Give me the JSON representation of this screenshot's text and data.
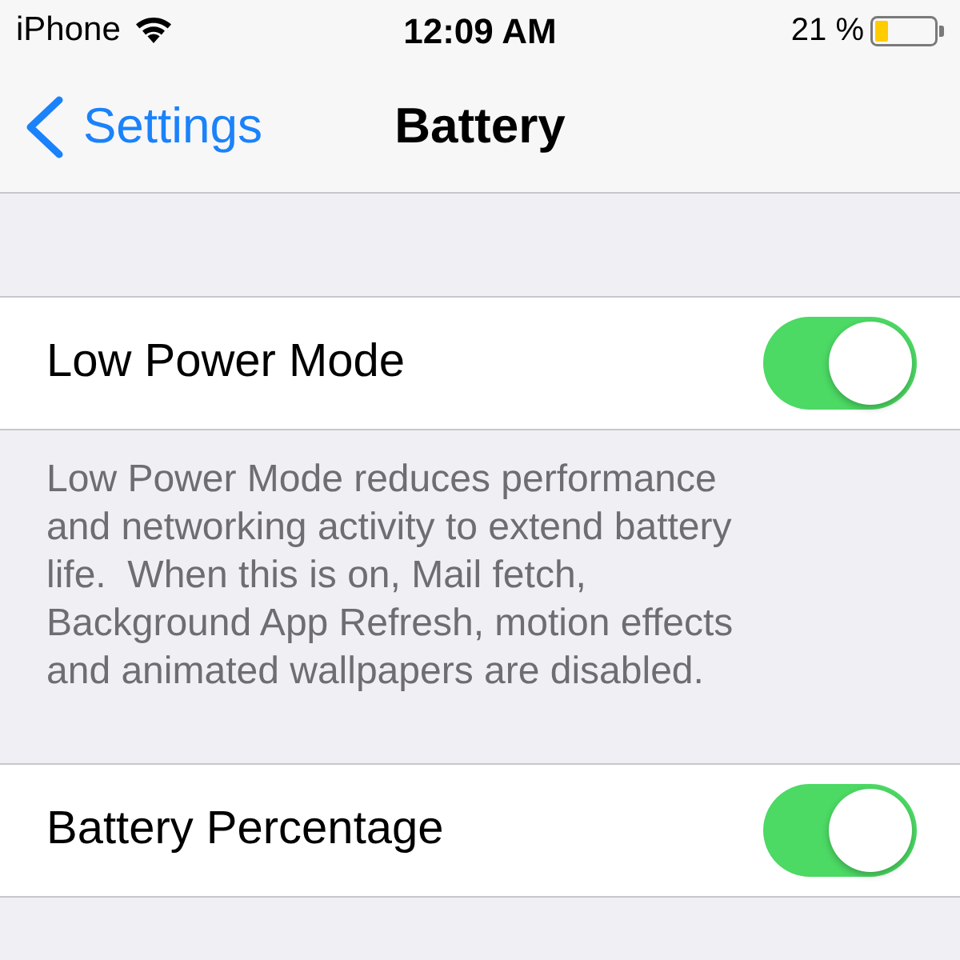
{
  "status_bar": {
    "carrier": "iPhone",
    "time": "12:09 AM",
    "battery_percent": "21 %"
  },
  "nav_bar": {
    "back_label": "Settings",
    "title": "Battery"
  },
  "sections": [
    {
      "label": "Low Power Mode",
      "on": true,
      "footer": "Low Power Mode reduces performance and networking activity to extend battery life.  When this is on, Mail fetch, Background App Refresh, motion effects and animated wallpapers are disabled."
    },
    {
      "label": "Battery Percentage",
      "on": true
    }
  ]
}
